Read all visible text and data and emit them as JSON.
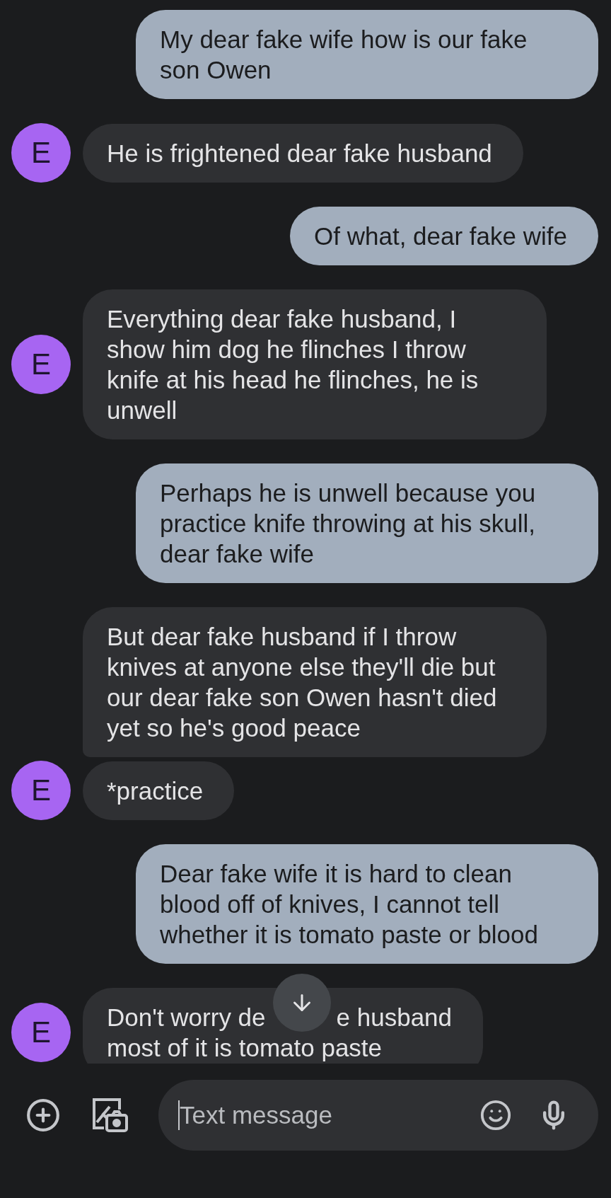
{
  "messages": [
    {
      "kind": "sent",
      "text": "My dear fake wife how is our fake son Owen"
    },
    {
      "kind": "received",
      "text": "He is frightened dear fake husband",
      "avatar": "E"
    },
    {
      "kind": "sent",
      "text": "Of what, dear fake wife"
    },
    {
      "kind": "received",
      "text": "Everything dear fake husband, I show him dog he flinches I throw knife at his head he flinches, he is unwell",
      "avatar": "E"
    },
    {
      "kind": "sent",
      "text": "Perhaps he is unwell because you practice knife throwing at his skull, dear fake wife"
    },
    {
      "kind": "received",
      "text": "But dear fake husband if I throw knives at anyone else they'll die but our dear fake son Owen hasn't died yet so he's good peace",
      "grouped": true
    },
    {
      "kind": "received",
      "text": "*practice",
      "avatar": "E"
    },
    {
      "kind": "sent",
      "text": "Dear fake wife it is hard to clean blood off of knives, I cannot tell whether it is tomato paste or blood"
    },
    {
      "kind": "received",
      "covered": true,
      "parts": [
        "Don't worry de",
        "e husband",
        "most of it is tomato paste"
      ],
      "avatar": "E"
    }
  ],
  "composer": {
    "placeholder": "Text message"
  }
}
